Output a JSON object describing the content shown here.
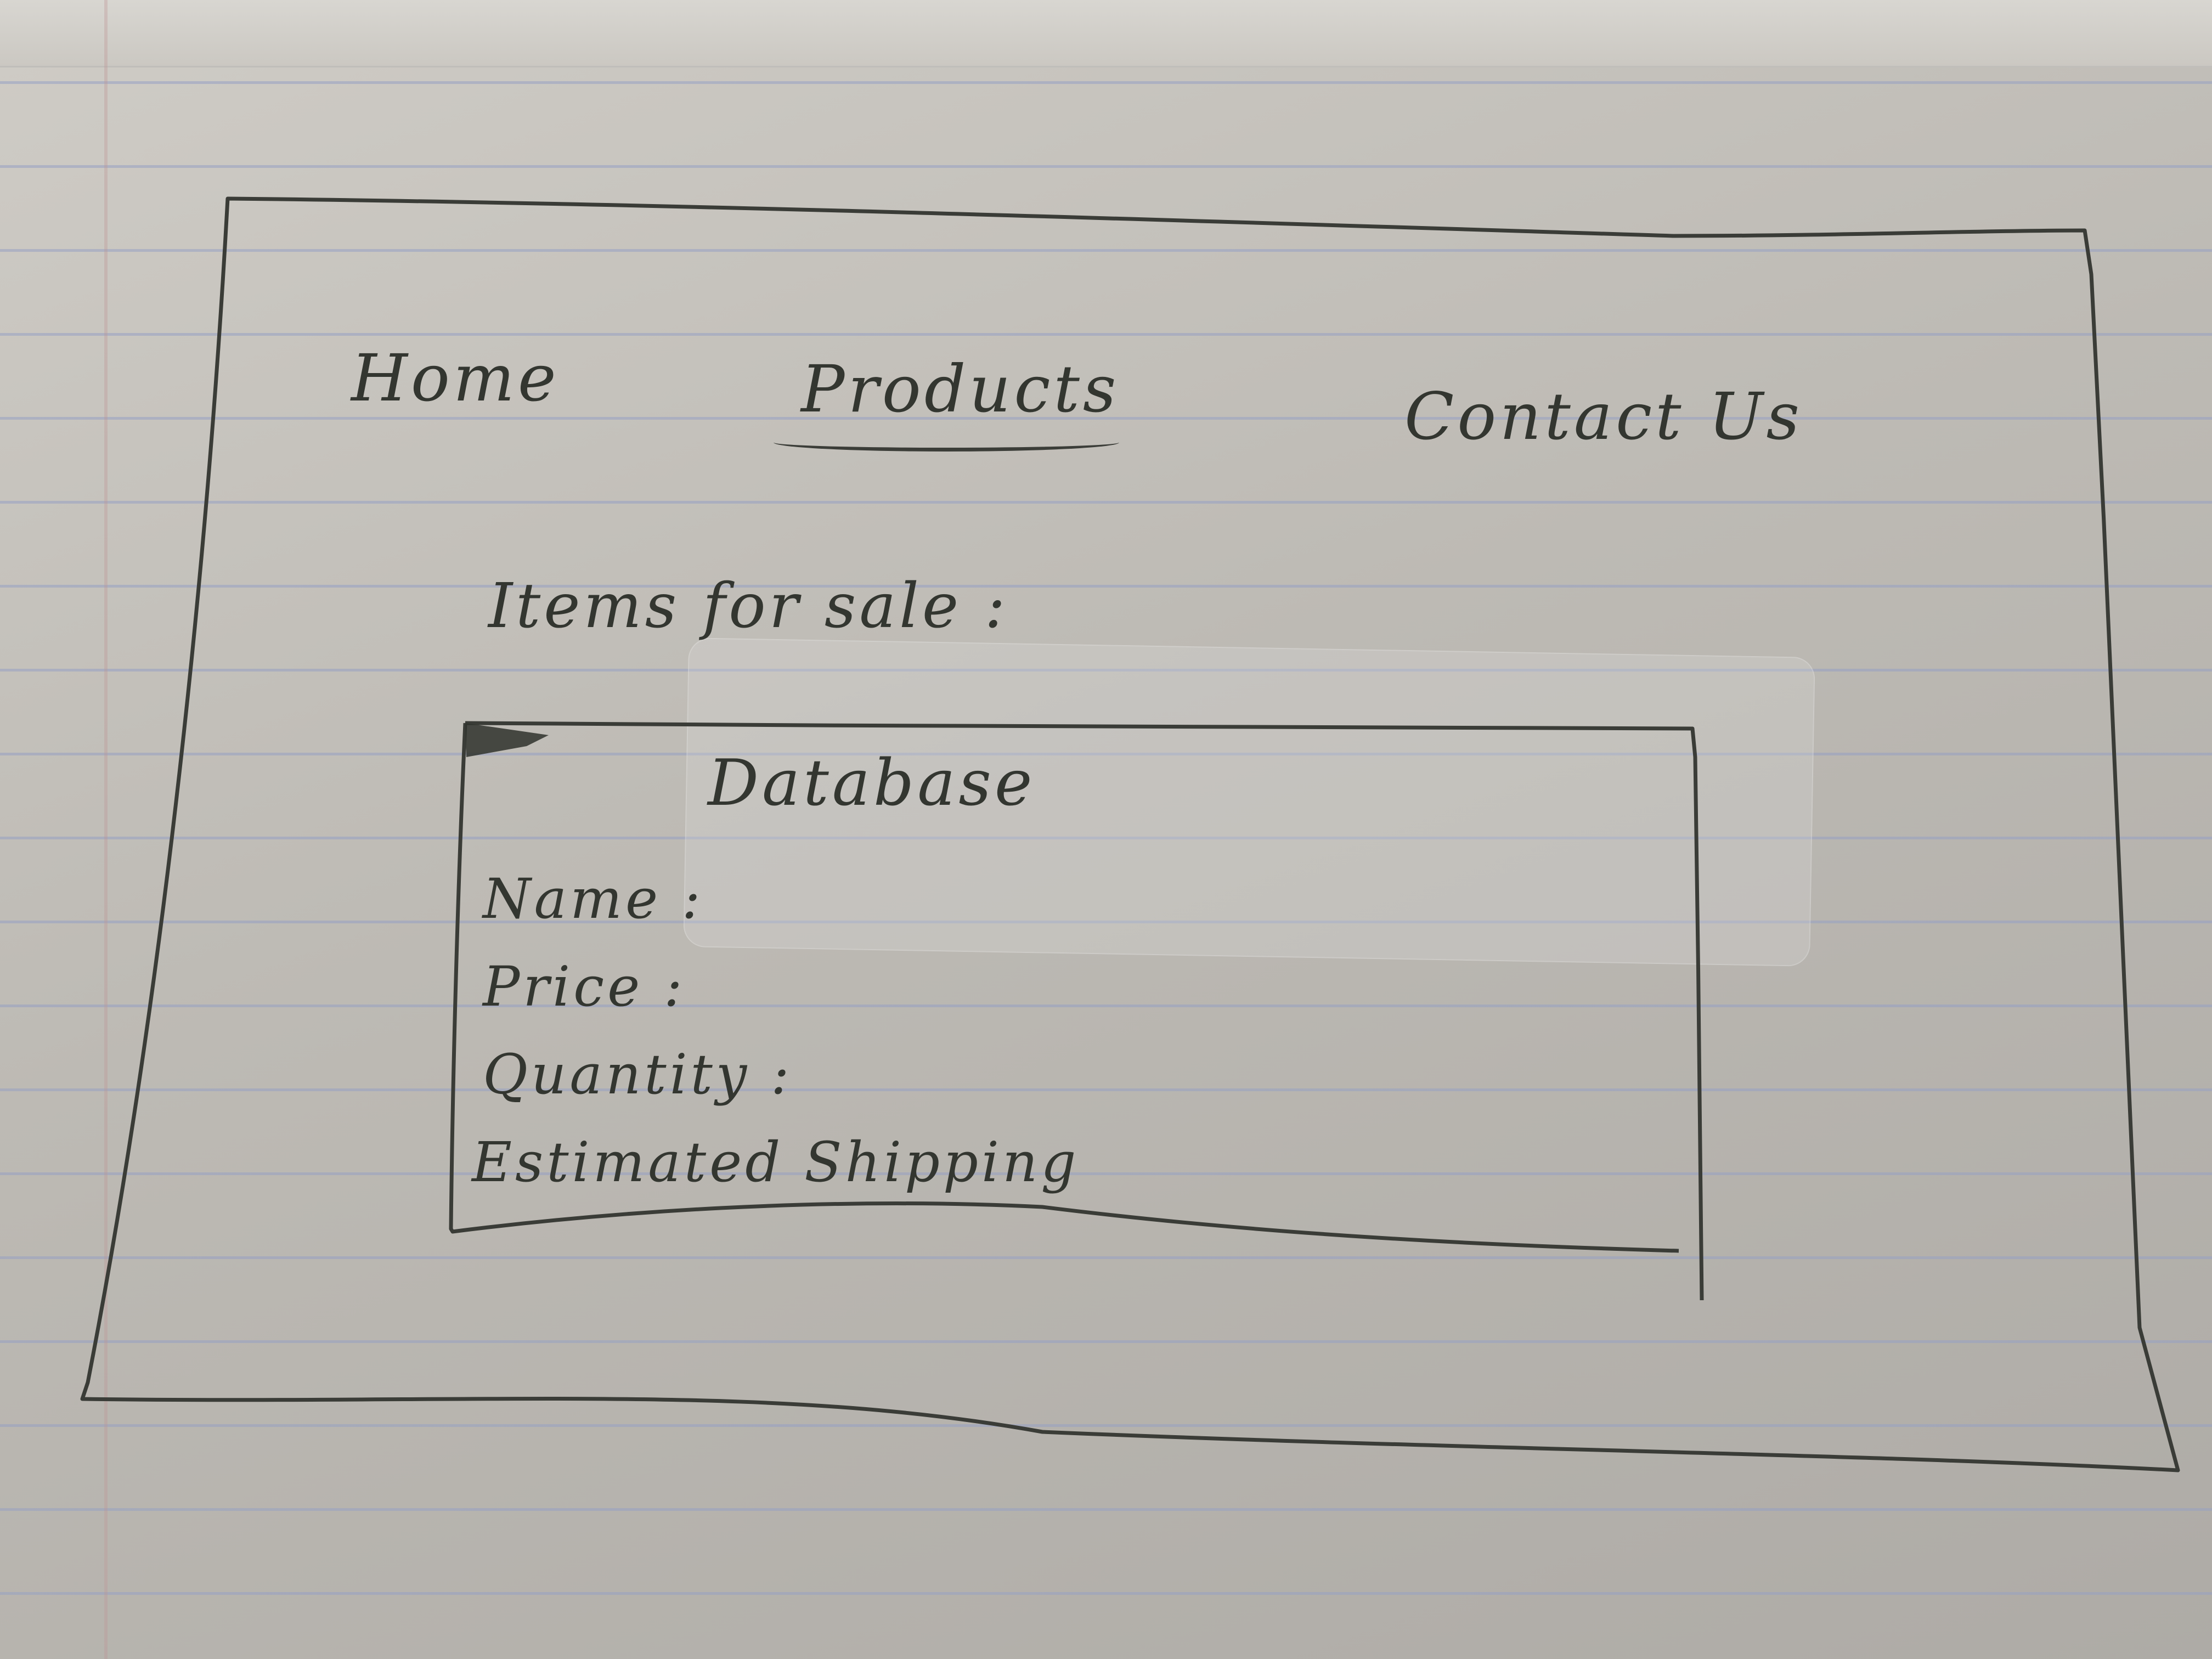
{
  "nav": {
    "items": [
      {
        "label": "Home"
      },
      {
        "label": "Products",
        "active": true
      },
      {
        "label": "Contact Us"
      }
    ]
  },
  "section": {
    "heading": "Items for sale :"
  },
  "database": {
    "title": "Database",
    "fields": [
      {
        "label": "Name :"
      },
      {
        "label": "Price :"
      },
      {
        "label": "Quantity :"
      },
      {
        "label": "Estimated Shipping"
      }
    ]
  },
  "colors": {
    "ink": "#333630",
    "paper": "#c7c4be",
    "rule_lines": "#96a0c3"
  }
}
